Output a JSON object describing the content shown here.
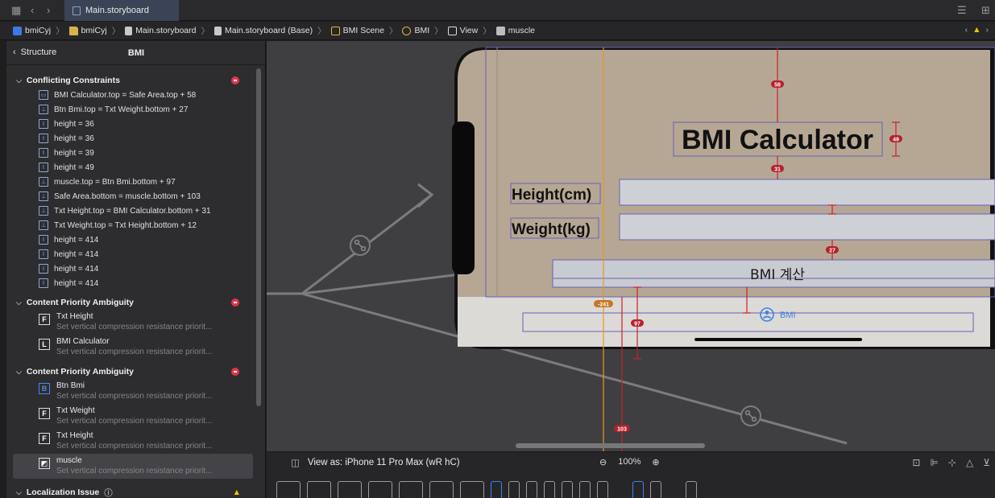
{
  "tabbar": {
    "tab_label": "Main.storyboard"
  },
  "jumpbar": {
    "items": [
      "bmiCyj",
      "bmiCyj",
      "Main.storyboard",
      "Main.storyboard (Base)",
      "BMI Scene",
      "BMI",
      "View",
      "muscle"
    ]
  },
  "panel": {
    "back_label": "Structure",
    "title": "BMI",
    "groups": [
      {
        "title": "Conflicting Constraints",
        "rows": [
          "BMI Calculator.top = Safe Area.top + 58",
          "Btn Bmi.top = Txt Weight.bottom + 27",
          "height = 36",
          "height = 36",
          "height = 39",
          "height = 49",
          "muscle.top = Btn Bmi.bottom + 97",
          "Safe Area.bottom = muscle.bottom + 103",
          "Txt Height.top = BMI Calculator.bottom + 31",
          "Txt Weight.top = Txt Height.bottom + 12",
          "height = 414",
          "height = 414",
          "height = 414",
          "height = 414"
        ]
      },
      {
        "title": "Content Priority Ambiguity",
        "items": [
          {
            "letter": "F",
            "name": "Txt Height",
            "desc": "Set vertical compression resistance priorit..."
          },
          {
            "letter": "L",
            "name": "BMI Calculator",
            "desc": "Set vertical compression resistance priorit..."
          }
        ]
      },
      {
        "title": "Content Priority Ambiguity",
        "items": [
          {
            "letter": "B",
            "name": "Btn Bmi",
            "desc": "Set vertical compression resistance priorit..."
          },
          {
            "letter": "F",
            "name": "Txt Weight",
            "desc": "Set vertical compression resistance priorit..."
          },
          {
            "letter": "F",
            "name": "Txt Height",
            "desc": "Set vertical compression resistance priorit..."
          },
          {
            "letter": "img",
            "name": "muscle",
            "desc": "Set vertical compression resistance priorit..."
          }
        ]
      },
      {
        "title": "Localization Issue"
      }
    ]
  },
  "canvas": {
    "app_title": "BMI Calculator",
    "height_label": "Height(cm)",
    "weight_label": "Weight(kg)",
    "button_label": "BMI 계산",
    "tab_item_label": "BMI",
    "constraint_badges": [
      "58",
      "49",
      "31",
      "27",
      "-241",
      "97",
      "103"
    ],
    "colors": {
      "phone_bg": "#b6a794",
      "field_bg": "#cdd1d6",
      "accent_blue": "#3d82e6",
      "constraint_red": "#d01d2a"
    }
  },
  "bottombar": {
    "view_as": "View as: iPhone 11 Pro Max (wR hC)",
    "zoom": "100%"
  }
}
